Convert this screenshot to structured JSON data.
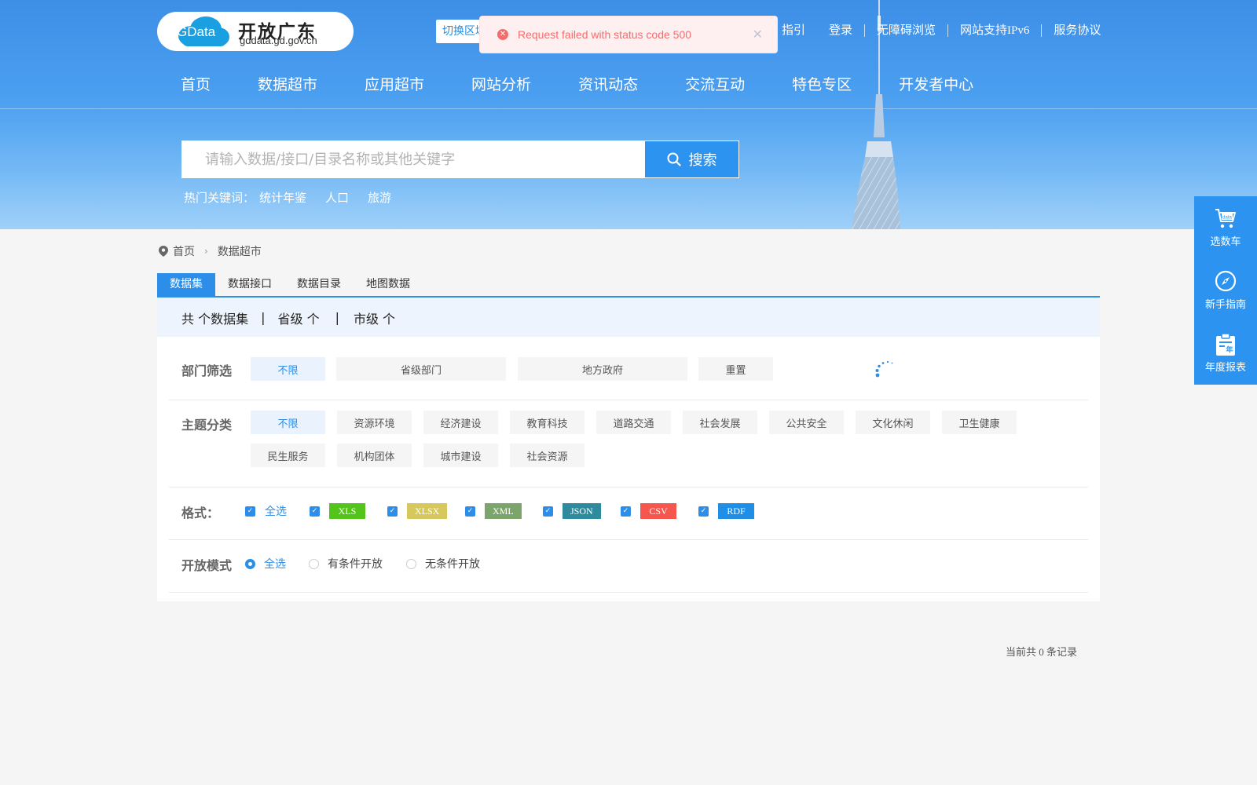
{
  "logo": {
    "badge": "GData",
    "title": "开放广东",
    "domain": "gddata.gd.gov.cn"
  },
  "region_switch": {
    "label": "切换区域"
  },
  "top_links": [
    "指引",
    "登录",
    "无障碍浏览",
    "网站支持IPv6",
    "服务协议"
  ],
  "nav": [
    "首页",
    "数据超市",
    "应用超市",
    "网站分析",
    "资讯动态",
    "交流互动",
    "特色专区",
    "开发者中心"
  ],
  "search": {
    "placeholder": "请输入数据/接口/目录名称或其他关键字",
    "button": "搜索"
  },
  "hot_keywords": {
    "label": "热门关键词：",
    "items": [
      "统计年鉴",
      "人口",
      "旅游"
    ]
  },
  "toast": {
    "message": "Request failed with status code 500"
  },
  "breadcrumb": [
    "首页",
    "数据超市"
  ],
  "tabs": [
    "数据集",
    "数据接口",
    "数据目录",
    "地图数据"
  ],
  "stats": {
    "total": "共 个数据集",
    "province": "省级 个",
    "city": "市级 个"
  },
  "dept_filter": {
    "label": "部门筛选",
    "options": [
      "不限",
      "省级部门",
      "地方政府",
      "重置"
    ]
  },
  "topic_filter": {
    "label": "主题分类",
    "options": [
      "不限",
      "资源环境",
      "经济建设",
      "教育科技",
      "道路交通",
      "社会发展",
      "公共安全",
      "文化休闲",
      "卫生健康",
      "民生服务",
      "机构团体",
      "城市建设",
      "社会资源"
    ]
  },
  "format_filter": {
    "label": "格式：",
    "all": "全选",
    "formats": [
      {
        "name": "XLS",
        "color": "#52c41a"
      },
      {
        "name": "XLSX",
        "color": "#d6c85c"
      },
      {
        "name": "XML",
        "color": "#7ca56b"
      },
      {
        "name": "JSON",
        "color": "#2e8b9e"
      },
      {
        "name": "CSV",
        "color": "#f5574e"
      },
      {
        "name": "RDF",
        "color": "#1e8ee6"
      }
    ]
  },
  "open_mode": {
    "label": "开放模式",
    "options": [
      "全选",
      "有条件开放",
      "无条件开放"
    ],
    "selected": 0
  },
  "record_count": "当前共 0 条记录",
  "side_float": [
    "选数车",
    "新手指南",
    "年度报表"
  ],
  "colors": {
    "primary": "#2c8ee8",
    "error": "#f56c6c",
    "header_top": "#3d8fe6"
  }
}
